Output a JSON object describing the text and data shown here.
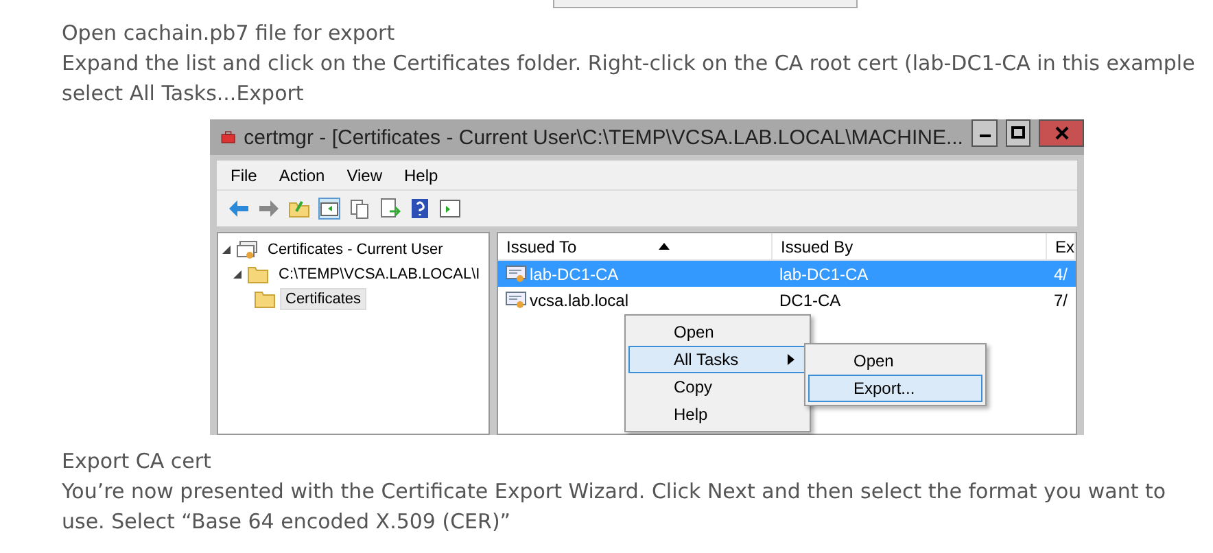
{
  "article": {
    "heading_1": "Open cachain.pb7 file for export",
    "paragraph_1": "Expand the list and click on the Certificates folder. Right-click on the CA root cert (lab-DC1-CA in this example",
    "paragraph_1b": "select All Tasks...Export",
    "heading_2": "Export CA cert",
    "paragraph_2": "You’re now presented with the Certificate Export Wizard. Click Next and then select the format you want to use. Select “Base 64 encoded X.509 (CER)”"
  },
  "window": {
    "title": "certmgr - [Certificates - Current User\\C:\\TEMP\\VCSA.LAB.LOCAL\\MACHINE...",
    "menu": [
      "File",
      "Action",
      "View",
      "Help"
    ],
    "tree": [
      {
        "label": "Certificates - Current User",
        "kind": "store",
        "expanded": true,
        "children": [
          {
            "label": "C:\\TEMP\\VCSA.LAB.LOCAL\\I",
            "kind": "folder",
            "expanded": true,
            "children": [
              {
                "label": "Certificates",
                "kind": "folder",
                "selected": true
              }
            ]
          }
        ]
      }
    ],
    "columns": [
      "Issued To",
      "Issued By",
      "Ex"
    ],
    "rows": [
      {
        "cells": [
          "lab-DC1-CA",
          "lab-DC1-CA",
          "4/"
        ],
        "selected": true
      },
      {
        "cells": [
          "vcsa.lab.local",
          "DC1-CA",
          "7/"
        ],
        "selected": false
      }
    ],
    "context_menu": [
      {
        "label": "Open",
        "highlighted": false,
        "submenu": false
      },
      {
        "label": "All Tasks",
        "highlighted": true,
        "submenu": true
      },
      {
        "label": "Copy",
        "highlighted": false,
        "submenu": false
      },
      {
        "label": "Help",
        "highlighted": false,
        "submenu": false
      }
    ],
    "submenu": [
      {
        "label": "Open",
        "highlighted": false
      },
      {
        "label": "Export...",
        "highlighted": true
      }
    ]
  }
}
